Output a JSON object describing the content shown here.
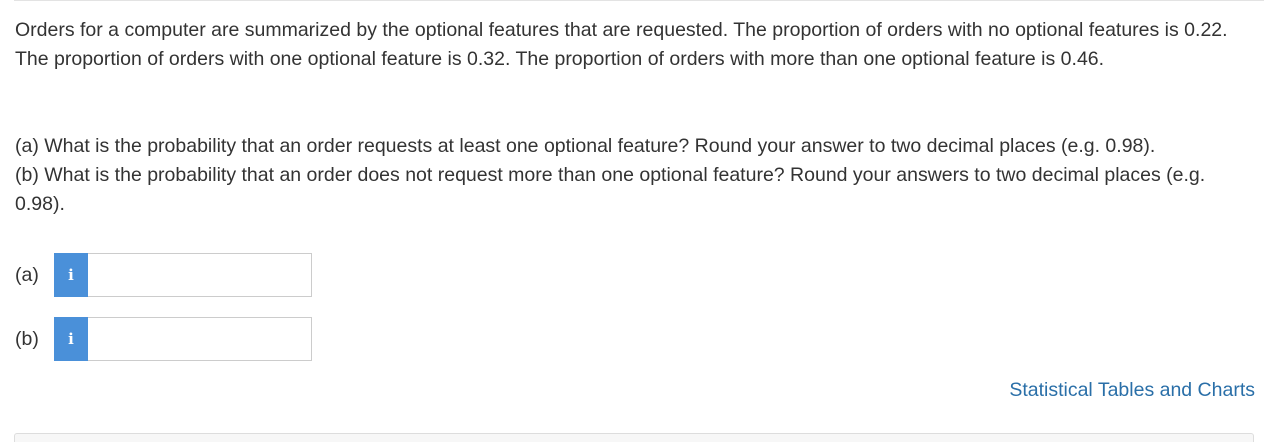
{
  "problem": {
    "text": "Orders for a computer are summarized by the optional features that are requested. The proportion of orders with no optional features is 0.22. The proportion of orders with one optional feature is 0.32. The proportion of orders with more than one optional feature is 0.46."
  },
  "questions": {
    "a": "(a) What is the probability that an order requests at least one optional feature? Round your answer to two decimal places (e.g. 0.98).",
    "b": "(b) What is the probability that an order does not request more than one optional feature? Round your answers to two decimal places (e.g. 0.98)."
  },
  "answers": [
    {
      "label": "(a)",
      "info_icon": "i",
      "value": ""
    },
    {
      "label": "(b)",
      "info_icon": "i",
      "value": ""
    }
  ],
  "links": {
    "tables": "Statistical Tables and Charts"
  },
  "colors": {
    "info_button": "#4a90d9",
    "link": "#2a6fa8",
    "text": "#333333"
  }
}
